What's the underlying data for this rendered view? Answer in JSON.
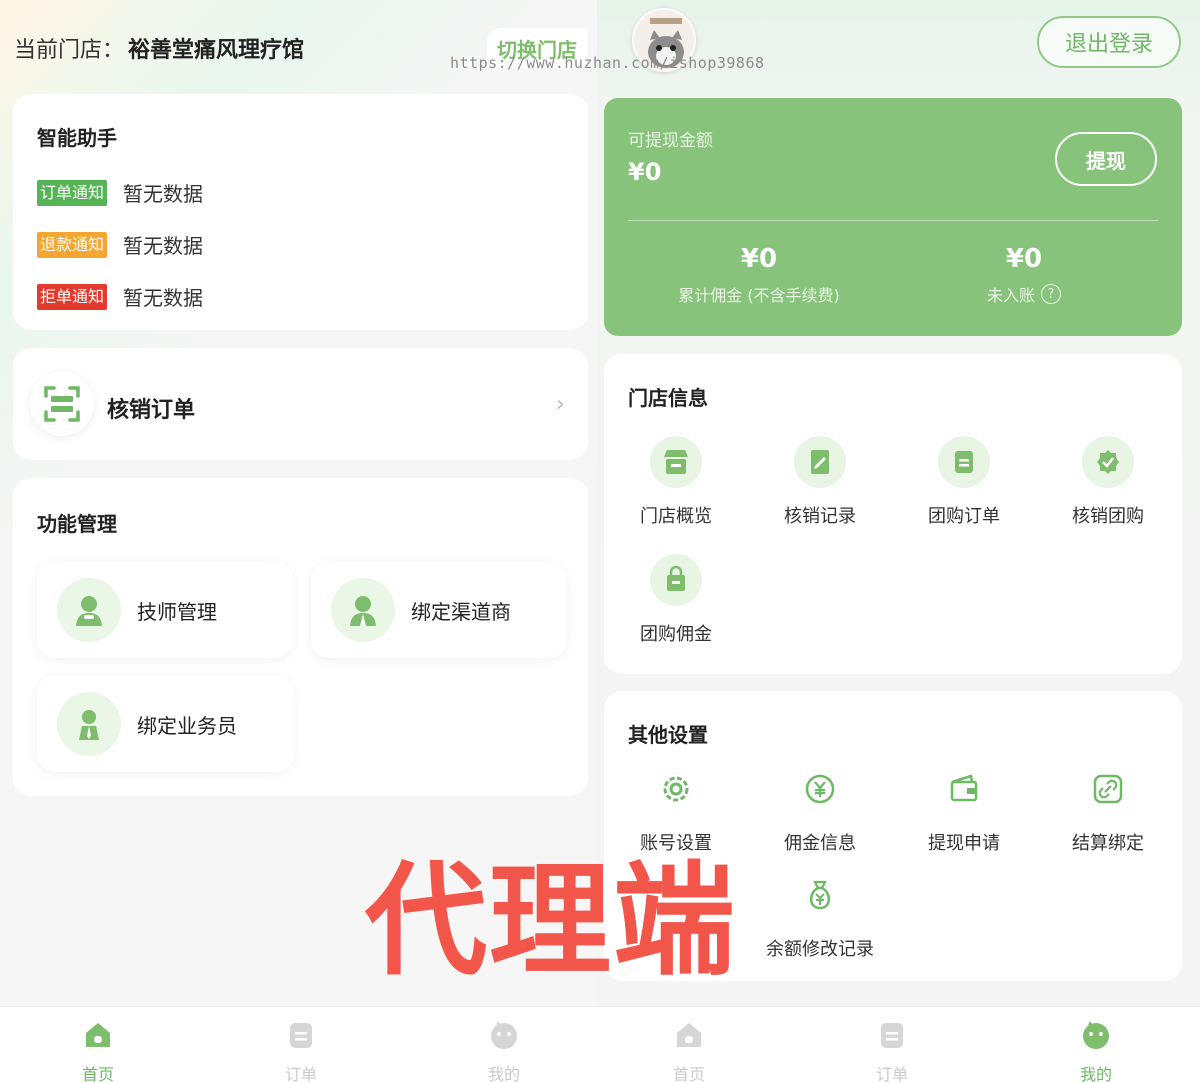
{
  "left": {
    "store_label": "当前门店：",
    "store_name": "裕善堂痛风理疗馆",
    "switch_store": "切换门店",
    "assistant": {
      "title": "智能助手",
      "items": [
        {
          "tag": "订单通知",
          "text": "暂无数据",
          "color": "#56b356"
        },
        {
          "tag": "退款通知",
          "text": "暂无数据",
          "color": "#f5a531"
        },
        {
          "tag": "拒单通知",
          "text": "暂无数据",
          "color": "#e23b2e"
        }
      ]
    },
    "verify_order": "核销订单",
    "functions": {
      "title": "功能管理",
      "items": [
        {
          "label": "技师管理",
          "icon": "technician-icon"
        },
        {
          "label": "绑定渠道商",
          "icon": "channel-partner-icon"
        },
        {
          "label": "绑定业务员",
          "icon": "salesperson-icon"
        }
      ]
    }
  },
  "right": {
    "logout": "退出登录",
    "wallet": {
      "withdrawable_label": "可提现金额",
      "withdrawable_amount": "¥0",
      "withdraw_button": "提现",
      "total_commission_value": "¥0",
      "total_commission_label": "累计佣金 (不含手续费)",
      "pending_value": "¥0",
      "pending_label": "未入账",
      "help_glyph": "?"
    },
    "store_info": {
      "title": "门店信息",
      "items": [
        {
          "label": "门店概览",
          "icon": "store-icon"
        },
        {
          "label": "核销记录",
          "icon": "record-icon"
        },
        {
          "label": "团购订单",
          "icon": "order-icon"
        },
        {
          "label": "核销团购",
          "icon": "check-badge-icon"
        },
        {
          "label": "团购佣金",
          "icon": "commission-bag-icon"
        }
      ]
    },
    "other_settings": {
      "title": "其他设置",
      "items": [
        {
          "label": "账号设置",
          "icon": "gear-icon"
        },
        {
          "label": "佣金信息",
          "icon": "yen-circle-icon"
        },
        {
          "label": "提现申请",
          "icon": "wallet-icon"
        },
        {
          "label": "结算绑定",
          "icon": "link-icon"
        },
        {
          "label": "余额修改记录",
          "icon": "money-bag-icon"
        }
      ]
    }
  },
  "tabbar": {
    "left": [
      {
        "label": "首页",
        "active": true
      },
      {
        "label": "订单",
        "active": false
      },
      {
        "label": "我的",
        "active": false
      }
    ],
    "right": [
      {
        "label": "首页",
        "active": false
      },
      {
        "label": "订单",
        "active": false
      },
      {
        "label": "我的",
        "active": true
      }
    ]
  },
  "colors": {
    "accent": "#87c37b",
    "active_tab": "#6fb865",
    "inactive_tab": "#c9c9c9"
  },
  "watermark_url": "https://www.huzhan.com/ishop39868",
  "overlay_title": "代理端"
}
